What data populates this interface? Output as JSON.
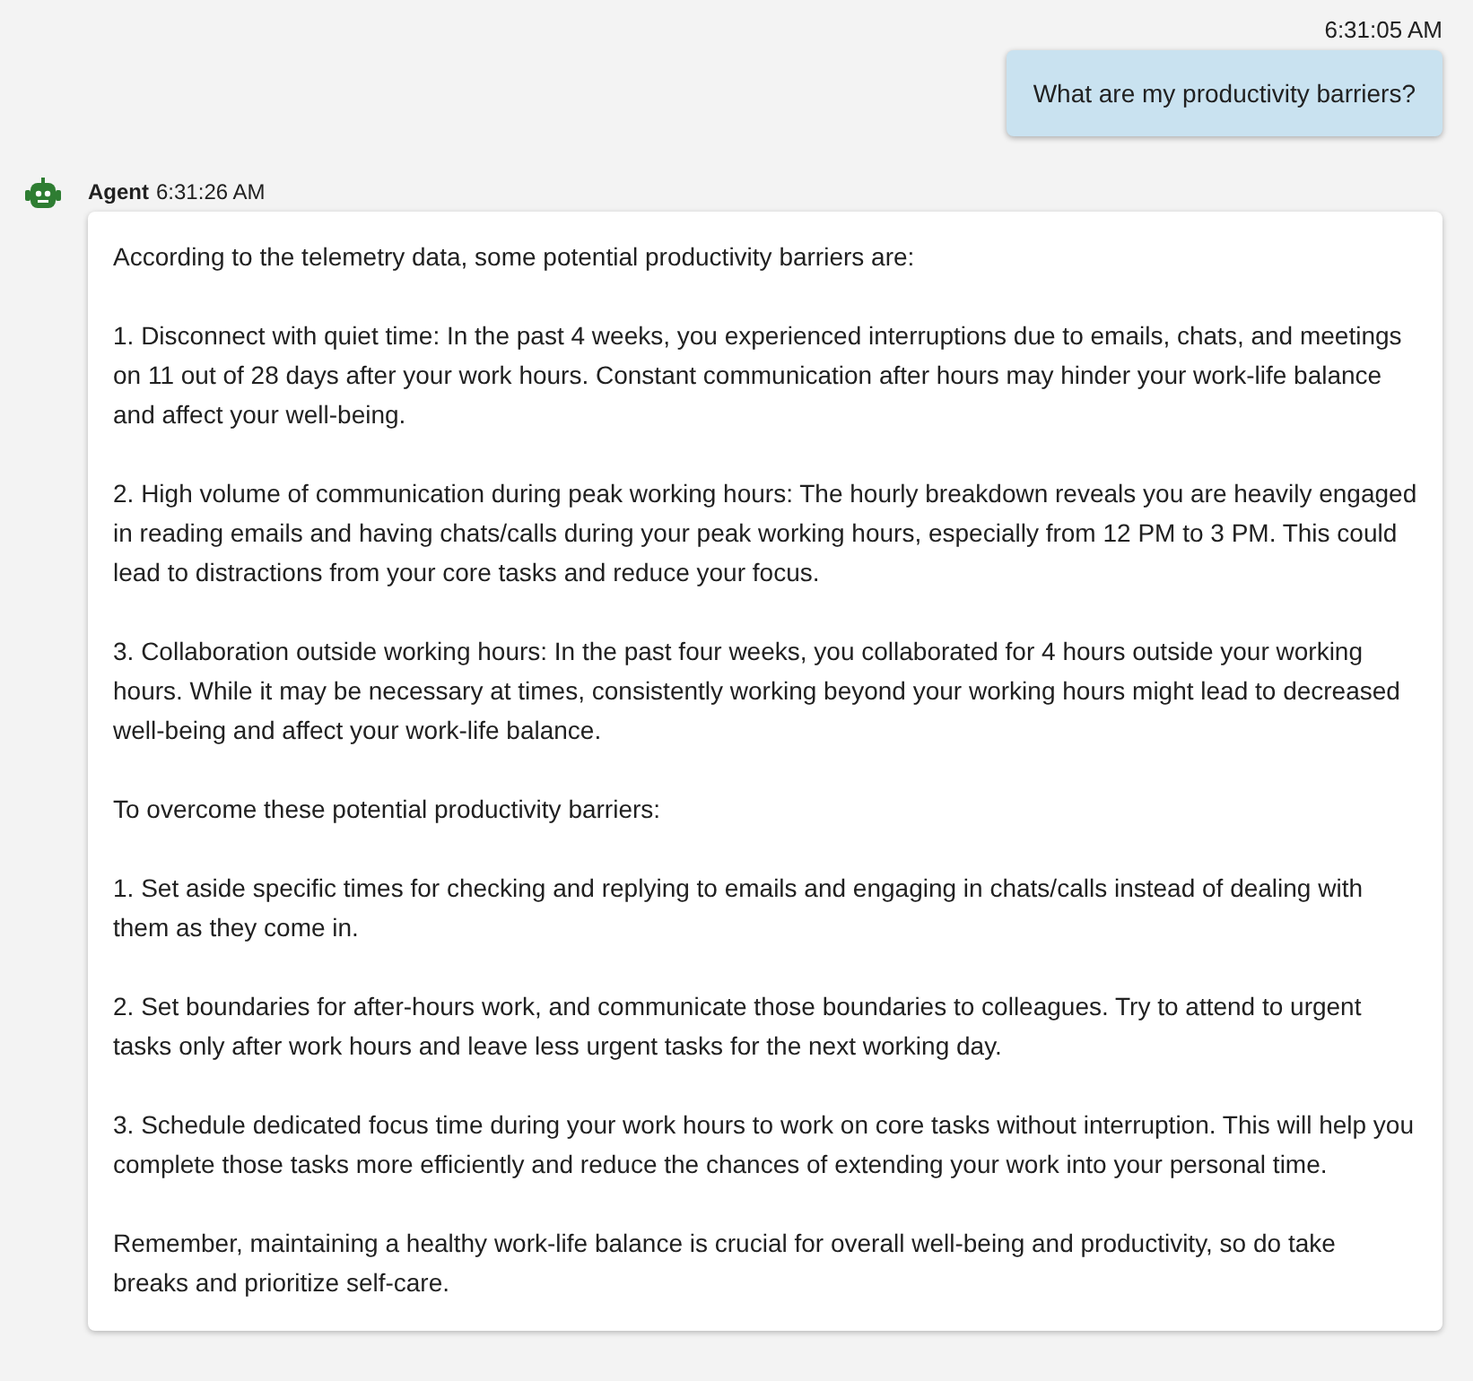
{
  "messages": [
    {
      "kind": "user",
      "time": "6:31:05 AM",
      "paragraphs": [
        "What are my productivity barriers?"
      ]
    },
    {
      "kind": "agent",
      "sender": "Agent",
      "time": "6:31:26 AM",
      "paragraphs": [
        "According to the telemetry data, some potential productivity barriers are:",
        "1. Disconnect with quiet time: In the past 4 weeks, you experienced interruptions due to emails, chats, and meetings on 11 out of 28 days after your work hours. Constant communication after hours may hinder your work-life balance and affect your well-being.",
        "2. High volume of communication during peak working hours: The hourly breakdown reveals you are heavily engaged in reading emails and having chats/calls during your peak working hours, especially from 12 PM to 3 PM. This could lead to distractions from your core tasks and reduce your focus.",
        "3. Collaboration outside working hours: In the past four weeks, you collaborated for 4 hours outside your working hours. While it may be necessary at times, consistently working beyond your working hours might lead to decreased well-being and affect your work-life balance.",
        "To overcome these potential productivity barriers:",
        "1. Set aside specific times for checking and replying to emails and engaging in chats/calls instead of dealing with them as they come in.",
        "2. Set boundaries for after-hours work, and communicate those boundaries to colleagues. Try to attend to urgent tasks only after work hours and leave less urgent tasks for the next working day.",
        "3. Schedule dedicated focus time during your work hours to work on core tasks without interruption. This will help you complete those tasks more efficiently and reduce the chances of extending your work into your personal time.",
        "Remember, maintaining a healthy work-life balance is crucial for overall well-being and productivity, so do take breaks and prioritize self-care."
      ]
    }
  ]
}
